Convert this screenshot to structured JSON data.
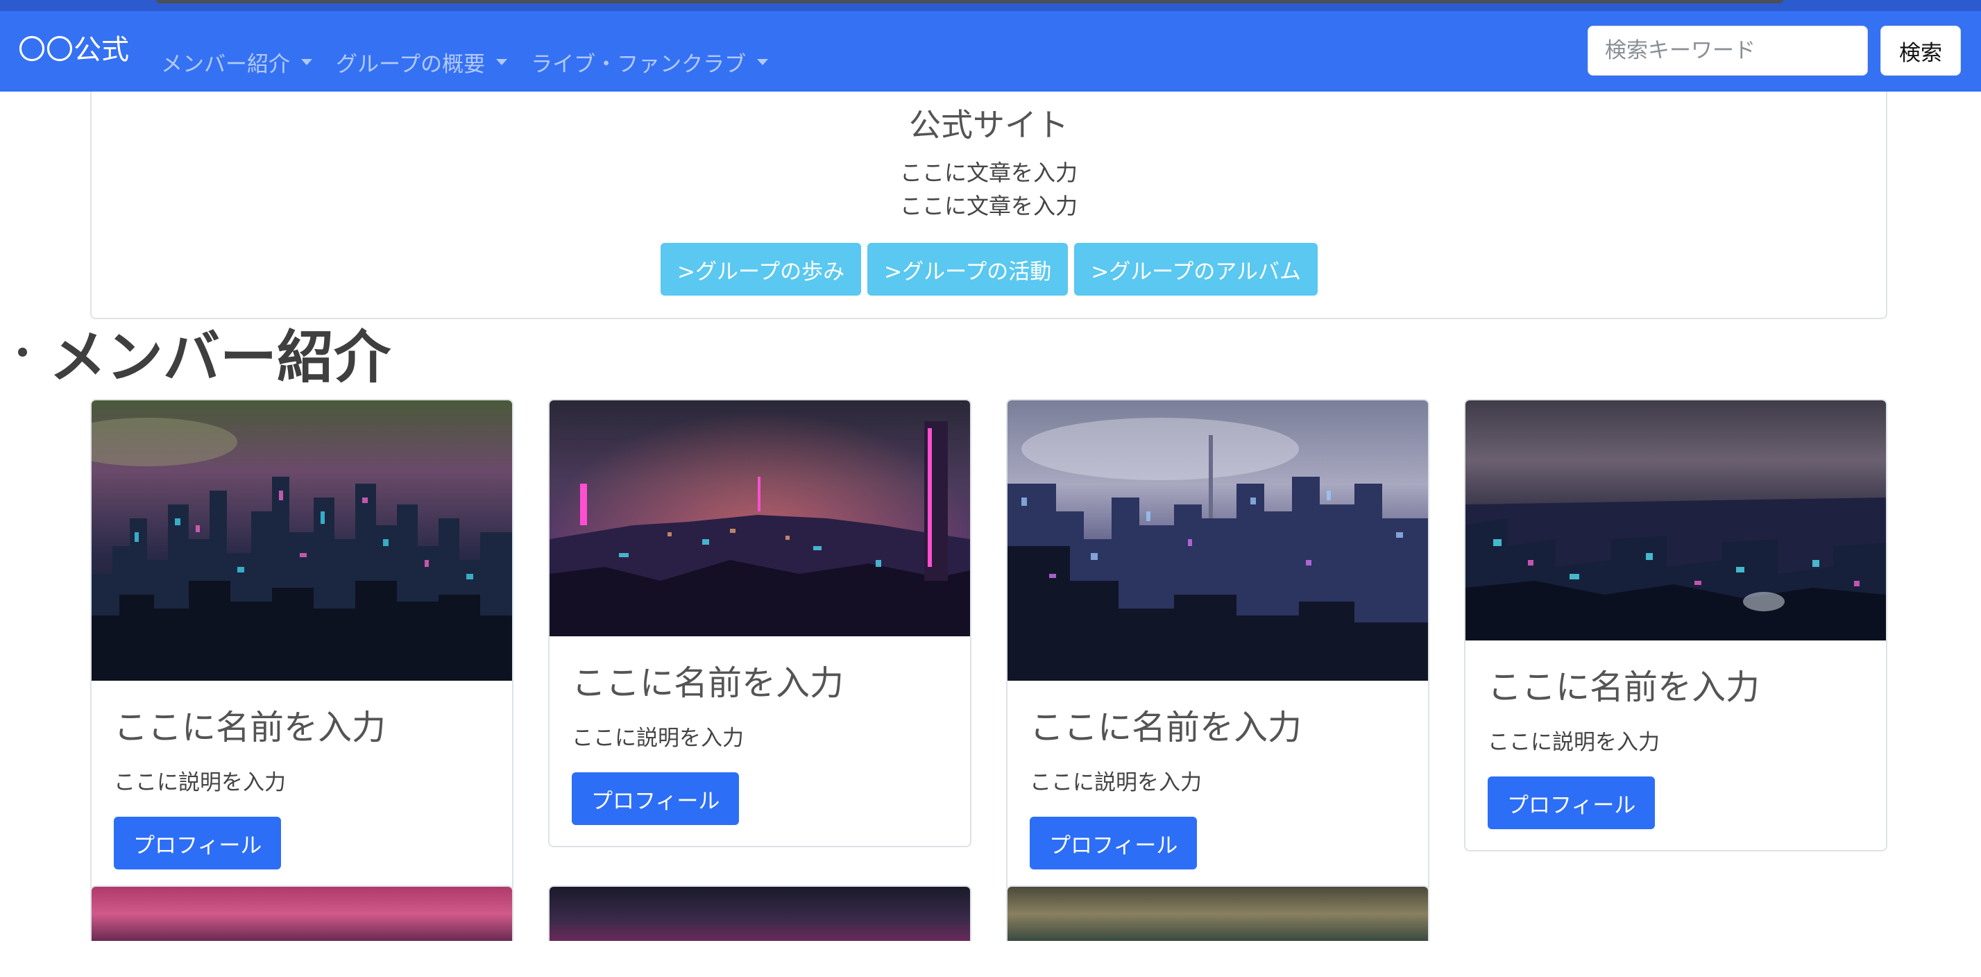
{
  "navbar": {
    "brand": "〇〇公式",
    "menu": [
      {
        "label": "メンバー紹介"
      },
      {
        "label": "グループの概要"
      },
      {
        "label": "ライブ・ファンクラブ"
      }
    ],
    "search": {
      "placeholder": "検索キーワード",
      "button_label": "検索"
    },
    "color": "#3571f3"
  },
  "hero": {
    "title": "公式サイト",
    "lines": [
      "ここに文章を入力",
      "ここに文章を入力"
    ],
    "buttons": [
      ">グループの歩み",
      ">グループの活動",
      ">グループのアルバム"
    ],
    "button_color": "#5ac8f0"
  },
  "members": {
    "heading": "メンバー紹介",
    "cards": [
      {
        "name": "ここに名前を入力",
        "description": "ここに説明を入力",
        "button": "プロフィール"
      },
      {
        "name": "ここに名前を入力",
        "description": "ここに説明を入力",
        "button": "プロフィール"
      },
      {
        "name": "ここに名前を入力",
        "description": "ここに説明を入力",
        "button": "プロフィール"
      },
      {
        "name": "ここに名前を入力",
        "description": "ここに説明を入力",
        "button": "プロフィール"
      }
    ],
    "button_color": "#2d6ef6"
  }
}
